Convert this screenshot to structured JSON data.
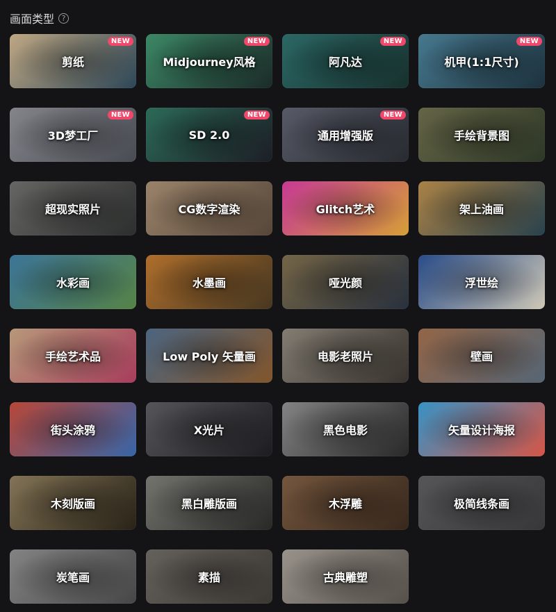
{
  "header": {
    "title": "画面类型",
    "help_icon": "question-circle-icon"
  },
  "badge_label": "NEW",
  "styles": [
    {
      "label": "剪纸",
      "new": true,
      "bg": [
        "#c9b08a",
        "#2f4a5c"
      ]
    },
    {
      "label": "Midjourney风格",
      "new": true,
      "bg": [
        "#3f8f6b",
        "#1c2d2a"
      ]
    },
    {
      "label": "阿凡达",
      "new": true,
      "bg": [
        "#2d6d6a",
        "#183330"
      ]
    },
    {
      "label": "机甲(1:1尺寸)",
      "new": true,
      "bg": [
        "#4a7f96",
        "#1e3440"
      ]
    },
    {
      "label": "3D梦工厂",
      "new": true,
      "bg": [
        "#8b8b92",
        "#4c4f57"
      ]
    },
    {
      "label": "SD 2.0",
      "new": true,
      "bg": [
        "#2e6f5b",
        "#1e1f28"
      ]
    },
    {
      "label": "通用增强版",
      "new": true,
      "bg": [
        "#5b5f6c",
        "#2a2c33"
      ]
    },
    {
      "label": "手绘背景图",
      "new": false,
      "bg": [
        "#6a6a4a",
        "#2f3a28"
      ]
    },
    {
      "label": "超现实照片",
      "new": false,
      "bg": [
        "#6b6b69",
        "#2e302f"
      ]
    },
    {
      "label": "CG数字渲染",
      "new": false,
      "bg": [
        "#a38a70",
        "#5a4a3c"
      ]
    },
    {
      "label": "Glitch艺术",
      "new": false,
      "bg": [
        "#d13c9c",
        "#e0a73a"
      ]
    },
    {
      "label": "架上油画",
      "new": false,
      "bg": [
        "#b3894a",
        "#2a4450"
      ]
    },
    {
      "label": "水彩画",
      "new": false,
      "bg": [
        "#3f7aa0",
        "#5a8a4a"
      ]
    },
    {
      "label": "水墨画",
      "new": false,
      "bg": [
        "#b8742e",
        "#4a3a22"
      ]
    },
    {
      "label": "哑光颜",
      "new": false,
      "bg": [
        "#7a6a4a",
        "#2a3340"
      ]
    },
    {
      "label": "浮世绘",
      "new": false,
      "bg": [
        "#2b4f8f",
        "#d8d2c0"
      ]
    },
    {
      "label": "手绘艺术品",
      "new": false,
      "bg": [
        "#c0a080",
        "#b04060"
      ]
    },
    {
      "label": "Low Poly 矢量画",
      "new": false,
      "bg": [
        "#4f6a86",
        "#8a5a2e"
      ]
    },
    {
      "label": "电影老照片",
      "new": false,
      "bg": [
        "#8a8378",
        "#3a3530"
      ]
    },
    {
      "label": "壁画",
      "new": false,
      "bg": [
        "#9a6a4a",
        "#5a6a7a"
      ]
    },
    {
      "label": "街头涂鸦",
      "new": false,
      "bg": [
        "#c24a3a",
        "#3a6ab0"
      ]
    },
    {
      "label": "X光片",
      "new": false,
      "bg": [
        "#5a5a5e",
        "#1e1e22"
      ]
    },
    {
      "label": "黑色电影",
      "new": false,
      "bg": [
        "#8a8a8a",
        "#2a2a2a"
      ]
    },
    {
      "label": "矢量设计海报",
      "new": false,
      "bg": [
        "#3a9ad0",
        "#e05a4a"
      ]
    },
    {
      "label": "木刻版画",
      "new": false,
      "bg": [
        "#8a7a5a",
        "#2a2418"
      ]
    },
    {
      "label": "黑白雕版画",
      "new": false,
      "bg": [
        "#7a7a74",
        "#2a2a28"
      ]
    },
    {
      "label": "木浮雕",
      "new": false,
      "bg": [
        "#7a5a40",
        "#3a2a1e"
      ]
    },
    {
      "label": "极简线条画",
      "new": false,
      "bg": [
        "#5a5a5c",
        "#3a3a3c"
      ]
    },
    {
      "label": "炭笔画",
      "new": false,
      "bg": [
        "#8a8a8a",
        "#4a4a4a"
      ]
    },
    {
      "label": "素描",
      "new": false,
      "bg": [
        "#6a6660",
        "#3e3a36"
      ]
    },
    {
      "label": "古典雕塑",
      "new": false,
      "bg": [
        "#a09a92",
        "#5a544e"
      ]
    }
  ]
}
